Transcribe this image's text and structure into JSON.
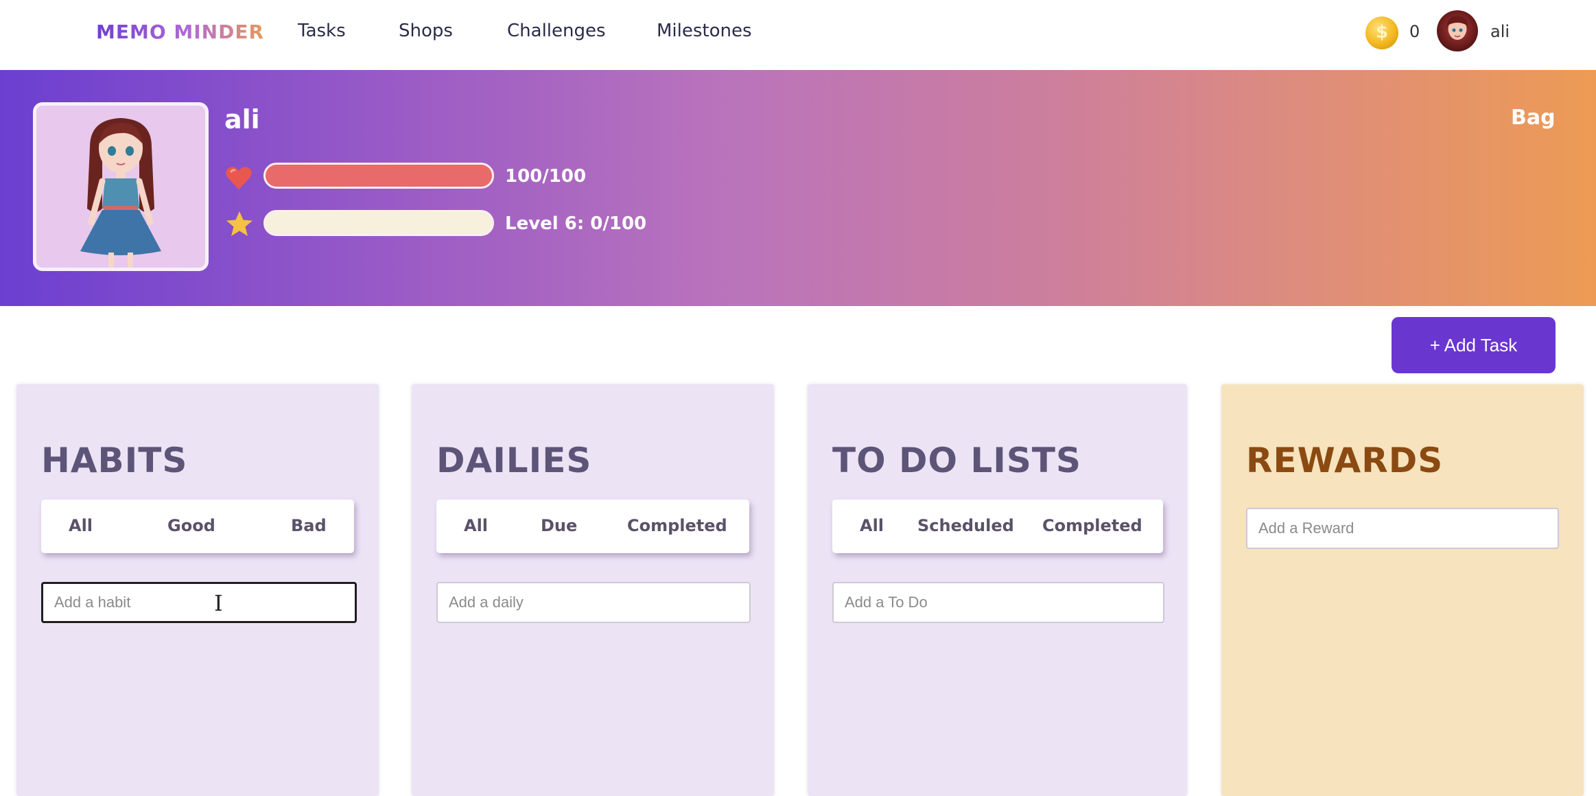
{
  "brand": {
    "name": "MEMO MINDER"
  },
  "nav": {
    "links": [
      "Tasks",
      "Shops",
      "Challenges",
      "Milestones"
    ],
    "coins": "0",
    "coin_symbol": "$",
    "username": "ali"
  },
  "profile": {
    "name": "ali",
    "bag_label": "Bag",
    "health": {
      "text": "100/100",
      "fraction": 1.0,
      "color": "#e96a6a"
    },
    "experience": {
      "text": "Level 6: 0/100",
      "fraction": 0.0,
      "color": "#f6f0dc"
    }
  },
  "add_task_label": "+ Add Task",
  "columns": {
    "habits": {
      "title": "HABITS",
      "filters": [
        "All",
        "Good",
        "Bad"
      ],
      "placeholder": "Add a habit"
    },
    "dailies": {
      "title": "DAILIES",
      "filters": [
        "All",
        "Due",
        "Completed"
      ],
      "placeholder": "Add a daily"
    },
    "todos": {
      "title": "TO DO LISTS",
      "filters": [
        "All",
        "Scheduled",
        "Completed"
      ],
      "placeholder": "Add a To Do"
    },
    "rewards": {
      "title": "REWARDS",
      "placeholder": "Add a Reward"
    }
  },
  "colors": {
    "accent": "#6a36d0",
    "column_bg": "#ece3f5",
    "rewards_bg": "#f7e3bd",
    "rewards_title": "#8a4a12"
  }
}
